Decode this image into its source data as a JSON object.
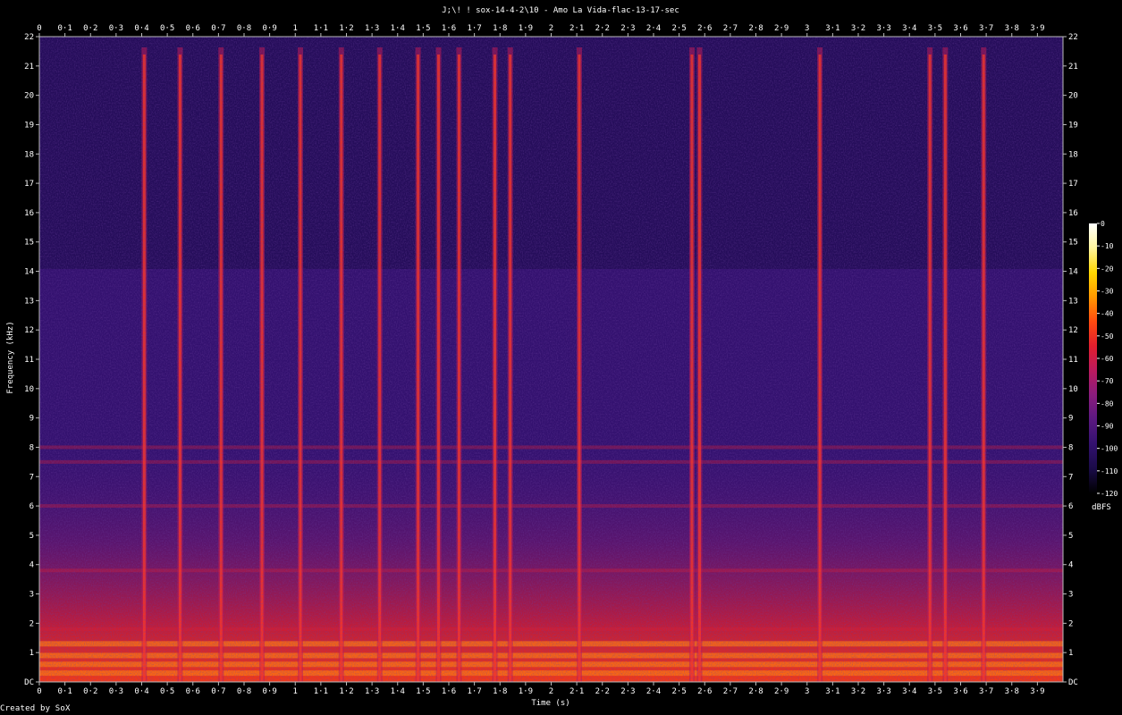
{
  "footer": {
    "created_by": "Created by SoX"
  },
  "chart_data": {
    "type": "heatmap",
    "title": "J;\\! ! sox-14-4-2\\10 - Amo La Vida-flac-13-17-sec",
    "xlabel": "Time (s)",
    "ylabel": "Frequency (kHz)",
    "xlim": [
      0,
      4.0
    ],
    "ylim": [
      0,
      22
    ],
    "x_ticks": [
      "0",
      "0·1",
      "0·2",
      "0·3",
      "0·4",
      "0·5",
      "0·6",
      "0·7",
      "0·8",
      "0·9",
      "1",
      "1·1",
      "1·2",
      "1·3",
      "1·4",
      "1·5",
      "1·6",
      "1·7",
      "1·8",
      "1·9",
      "2",
      "2·1",
      "2·2",
      "2·3",
      "2·4",
      "2·5",
      "2·6",
      "2·7",
      "2·8",
      "2·9",
      "3",
      "3·1",
      "3·2",
      "3·3",
      "3·4",
      "3·5",
      "3·6",
      "3·7",
      "3·8",
      "3·9"
    ],
    "y_ticks": [
      "DC",
      "1",
      "2",
      "3",
      "4",
      "5",
      "6",
      "7",
      "8",
      "9",
      "10",
      "11",
      "12",
      "13",
      "14",
      "15",
      "16",
      "17",
      "18",
      "19",
      "20",
      "21",
      "22"
    ],
    "colorbar": {
      "label": "dBFS",
      "ticks": [
        "0",
        "-10",
        "-20",
        "-30",
        "-40",
        "-50",
        "-60",
        "-70",
        "-80",
        "-90",
        "-100",
        "-110",
        "-120"
      ],
      "range": [
        -120,
        0
      ],
      "colors": [
        "#000000",
        "#1a0b48",
        "#33116f",
        "#5a1880",
        "#8a1c7e",
        "#bb1a5e",
        "#e11e2e",
        "#ff4a10",
        "#ff9800",
        "#ffd700",
        "#fff59d",
        "#ffffff"
      ]
    },
    "transients_s": [
      0.41,
      0.55,
      0.71,
      0.87,
      1.02,
      1.18,
      1.33,
      1.48,
      1.56,
      1.64,
      1.78,
      1.84,
      2.11,
      2.55,
      2.58,
      3.05,
      3.48,
      3.54,
      3.69
    ],
    "harmonic_bands_khz": [
      0.3,
      0.6,
      0.9,
      1.3,
      1.8,
      3.8,
      6.0,
      7.5,
      8.0
    ]
  }
}
